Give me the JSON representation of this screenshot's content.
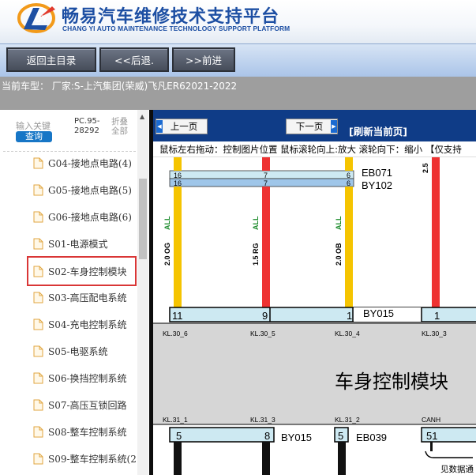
{
  "header": {
    "title": "畅易汽车维修技术支持平台",
    "subtitle": "CHANG YI AUTO MAINTENANCE TECHNOLOGY SUPPORT PLATFORM",
    "logo_icon": "cy-logo-icon"
  },
  "nav": {
    "home": "返回主目录",
    "back": "<<后退.",
    "forward": ">>前进"
  },
  "vehicle": {
    "text": "当前车型：  厂家:S-上汽集团(荣威)飞凡ER62021-2022"
  },
  "sidebar": {
    "keyword_label": "输入关键",
    "query": "查询",
    "pc_code_line1": "PC.95-",
    "pc_code_line2": "28292",
    "fold_line1": "折叠",
    "fold_line2": "全部",
    "items": [
      {
        "label": "G04-接地点电路(4)"
      },
      {
        "label": "G05-接地点电路(5)"
      },
      {
        "label": "G06-接地点电路(6)"
      },
      {
        "label": "S01-电源模式"
      },
      {
        "label": "S02-车身控制模块"
      },
      {
        "label": "S03-高压配电系统"
      },
      {
        "label": "S04-充电控制系统"
      },
      {
        "label": "S05-电驱系统"
      },
      {
        "label": "S06-换挡控制系统"
      },
      {
        "label": "S07-高压互锁回路"
      },
      {
        "label": "S08-整车控制系统"
      },
      {
        "label": "S09-整车控制系统(2"
      }
    ],
    "selected_index": 4
  },
  "viewer": {
    "prev_page": "上一页",
    "next_page": "下一页",
    "refresh": "[刷新当前页]",
    "hint": "鼠标左右拖动：控制图片位置  鼠标滚轮向上:放大  滚轮向下：缩小 【仅支持",
    "diagram": {
      "module_name": "车身控制模块",
      "connector_top_1": "EB071",
      "connector_top_2": "BY102",
      "connector_mid": "BY015",
      "connector_bottom_1": "BY015",
      "connector_bottom_2": "EB039",
      "top_pins_row1": [
        "16",
        "7",
        "6"
      ],
      "top_pins_row2": [
        "16",
        "7",
        "6"
      ],
      "mid_pins": [
        "11",
        "9",
        "1",
        "1"
      ],
      "wire_labels": [
        {
          "all": "ALL",
          "spec": "2.0 OG"
        },
        {
          "all": "ALL",
          "spec": "1.5 RG"
        },
        {
          "all": "ALL",
          "spec": "2.0 OB"
        }
      ],
      "right_wire_spec": "2.5",
      "terminals_top": [
        "KL.30_6",
        "KL.30_5",
        "KL.30_4",
        "KL.30_3"
      ],
      "terminals_bottom": [
        "KL.31_1",
        "KL.31_3",
        "KL.31_2",
        "CANH"
      ],
      "bottom_pins": [
        "5",
        "8",
        "5",
        "51"
      ],
      "bottom_note": "见数据通"
    },
    "colors": {
      "wire_yellow": "#f5c400",
      "wire_red": "#ee3232",
      "wire_black": "#111111",
      "connector_fill": "#cde9f2",
      "module_fill": "#d6d6d6",
      "toolbar_blue": "#0f3c87"
    }
  }
}
